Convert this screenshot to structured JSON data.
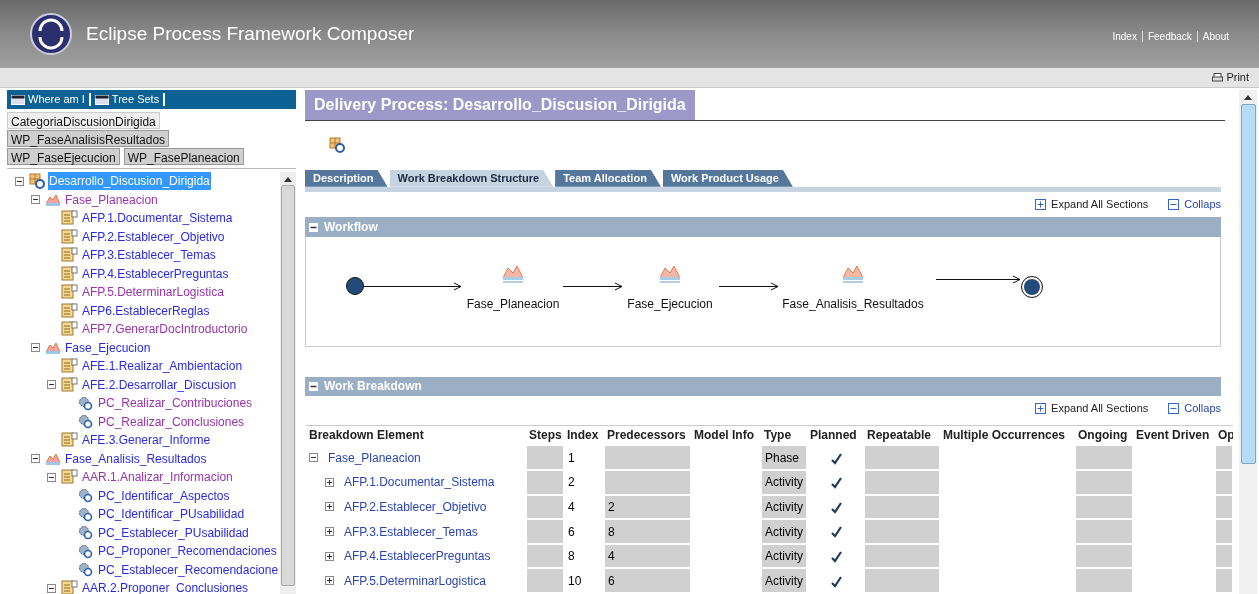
{
  "header": {
    "title": "Eclipse Process Framework Composer",
    "links": [
      {
        "label": "Index"
      },
      {
        "label": "Feedback"
      },
      {
        "label": "About"
      }
    ]
  },
  "toolbar": {
    "print": "Print"
  },
  "nav": {
    "tabs": [
      {
        "label": "Where am I"
      },
      {
        "label": "Tree Sets"
      }
    ],
    "tree_sets": [
      {
        "label": "CategoriaDiscusionDirigida",
        "selected": true
      },
      {
        "label": "WP_FaseAnalisisResultados",
        "selected": false
      },
      {
        "label": "WP_FaseEjecucion",
        "selected": false
      },
      {
        "label": "WP_FasePlaneacion",
        "selected": false
      }
    ]
  },
  "tree": [
    {
      "kind": "process",
      "label": "Desarrollo_Discusion_Dirigida",
      "selected": true,
      "expanded": true,
      "children": [
        {
          "kind": "phase",
          "label": "Fase_Planeacion",
          "selected": false,
          "visited": true,
          "expanded": true,
          "children": [
            {
              "kind": "activity",
              "label": "AFP.1.Documentar_Sistema",
              "selected": false,
              "visited": false
            },
            {
              "kind": "activity",
              "label": "AFP.2.Establecer_Objetivo",
              "selected": false,
              "visited": false
            },
            {
              "kind": "activity",
              "label": "AFP.3.Establecer_Temas",
              "selected": false,
              "visited": false
            },
            {
              "kind": "activity",
              "label": "AFP.4.EstablecerPreguntas",
              "selected": false,
              "visited": false
            },
            {
              "kind": "activity",
              "label": "AFP.5.DeterminarLogistica",
              "selected": false,
              "visited": true
            },
            {
              "kind": "activity",
              "label": "AFP6.EstablecerReglas",
              "selected": false,
              "visited": false
            },
            {
              "kind": "activity",
              "label": "AFP7.GenerarDocIntroductorio",
              "selected": false,
              "visited": true
            }
          ]
        },
        {
          "kind": "phase",
          "label": "Fase_Ejecucion",
          "selected": false,
          "visited": false,
          "expanded": true,
          "children": [
            {
              "kind": "activity",
              "label": "AFE.1.Realizar_Ambientacion",
              "selected": false,
              "visited": false
            },
            {
              "kind": "activity",
              "label": "AFE.2.Desarrollar_Discusion",
              "selected": false,
              "visited": false,
              "expanded": true,
              "children": [
                {
                  "kind": "pattern",
                  "label": "PC_Realizar_Contribuciones",
                  "selected": false,
                  "visited": true
                },
                {
                  "kind": "pattern",
                  "label": "PC_Realizar_Conclusiones",
                  "selected": false,
                  "visited": true
                }
              ]
            },
            {
              "kind": "activity",
              "label": "AFE.3.Generar_Informe",
              "selected": false,
              "visited": false
            }
          ]
        },
        {
          "kind": "phase",
          "label": "Fase_Analisis_Resultados",
          "selected": false,
          "visited": false,
          "expanded": true,
          "children": [
            {
              "kind": "activity",
              "label": "AAR.1.Analizar_Informacion",
              "selected": false,
              "visited": true,
              "expanded": true,
              "children": [
                {
                  "kind": "pattern",
                  "label": "PC_Identificar_Aspectos",
                  "selected": false,
                  "visited": false
                },
                {
                  "kind": "pattern",
                  "label": "PC_Identificar_PUsabilidad",
                  "selected": false,
                  "visited": false
                },
                {
                  "kind": "pattern",
                  "label": "PC_Establecer_PUsabilidad",
                  "selected": false,
                  "visited": false
                },
                {
                  "kind": "pattern",
                  "label": "PC_Proponer_Recomendaciones",
                  "selected": false,
                  "visited": false
                },
                {
                  "kind": "pattern",
                  "label": "PC_Establecer_Recomendacione",
                  "selected": false,
                  "visited": false
                }
              ]
            },
            {
              "kind": "activity",
              "label": "AAR.2.Proponer_Conclusiones",
              "selected": false,
              "visited": false,
              "expanded": true
            }
          ]
        }
      ]
    }
  ],
  "content": {
    "title": "Delivery Process: Desarrollo_Discusion_Dirigida",
    "tabs": [
      {
        "label": "Description",
        "selected": false
      },
      {
        "label": "Work Breakdown Structure",
        "selected": true
      },
      {
        "label": "Team Allocation",
        "selected": false
      },
      {
        "label": "Work Product Usage",
        "selected": false
      }
    ],
    "expand_all": "Expand All Sections",
    "collapse_all": "Collaps",
    "workflow": {
      "title": "Workflow",
      "expanded": true,
      "phases": [
        "Fase_Planeacion",
        "Fase_Ejecucion",
        "Fase_Analisis_Resultados"
      ]
    },
    "work_breakdown": {
      "title": "Work Breakdown",
      "expanded": true,
      "expand_all": "Expand All Sections",
      "collapse_all": "Collaps",
      "columns": [
        "Breakdown Element",
        "Steps",
        "Index",
        "Predecessors",
        "Model Info",
        "Type",
        "Planned",
        "Repeatable",
        "Multiple Occurrences",
        "Ongoing",
        "Event Driven",
        "Op"
      ],
      "rows": [
        {
          "element": "Fase_Planeacion",
          "expanded": true,
          "index": "1",
          "type": "Phase",
          "planned": true,
          "children": [
            {
              "element": "AFP.1.Documentar_Sistema",
              "expanded": false,
              "index": "2",
              "type": "Activity",
              "planned": true
            },
            {
              "element": "AFP.2.Establecer_Objetivo",
              "expanded": false,
              "index": "4",
              "predecessors": "2",
              "type": "Activity",
              "planned": true
            },
            {
              "element": "AFP.3.Establecer_Temas",
              "expanded": false,
              "index": "6",
              "predecessors": "8",
              "type": "Activity",
              "planned": true
            },
            {
              "element": "AFP.4.EstablecerPreguntas",
              "expanded": false,
              "index": "8",
              "predecessors": "4",
              "type": "Activity",
              "planned": true
            },
            {
              "element": "AFP.5.DeterminarLogistica",
              "expanded": false,
              "index": "10",
              "predecessors": "6",
              "type": "Activity",
              "planned": true
            }
          ]
        }
      ]
    }
  }
}
